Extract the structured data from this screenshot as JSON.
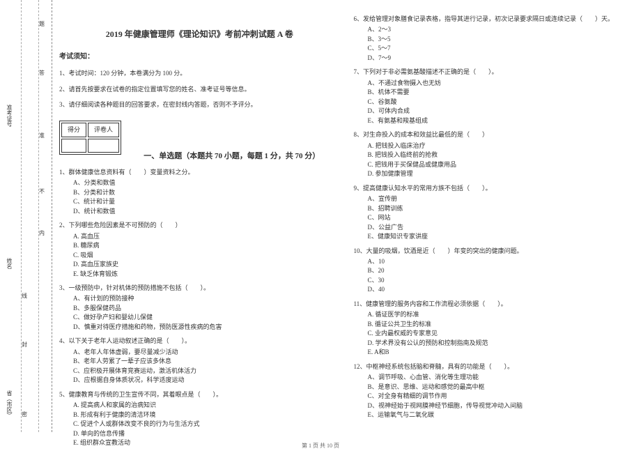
{
  "title": "2019 年健康管理师《理论知识》考前冲刺试题 A 卷",
  "noticeHeading": "考试须知：",
  "notices": [
    "1、考试时间：120 分钟，本卷满分为 100 分。",
    "2、请首先按要求在试卷的指定位置填写您的姓名、准考证号等信息。",
    "3、请仔细阅读各种题目的回答要求，在密封线内答题，否则不予评分。"
  ],
  "scoreHeaders": {
    "score": "得分",
    "reviewer": "评卷人"
  },
  "sectionTitle": "一、单选题（本题共 70 小题，每题 1 分，共 70 分）",
  "binding": {
    "province": "省（市区）",
    "seal": "密",
    "seal2": "封",
    "line": "线",
    "inner": "内",
    "dont": "不",
    "answer": "准",
    "do": "答",
    "question": "题",
    "name": "姓名",
    "admitNo": "准考证号"
  },
  "questions": [
    {
      "num": "1、",
      "text": "群体健康信息资料有（　　）变量资料之分。",
      "options": [
        "A、分类和数值",
        "B、分类和计数",
        "C、统计和计量",
        "D、统计和数值"
      ]
    },
    {
      "num": "2、",
      "text": "下列哪些危险因素是不可预防的（　　）",
      "options": [
        "A. 高血压",
        "B. 糖尿病",
        "C. 吸烟",
        "D. 高血压家族史",
        "E. 缺乏体育锻炼"
      ]
    },
    {
      "num": "3、",
      "text": "一级预防中，针对机体的预防措施不包括（　　）。",
      "options": [
        "A、有计划的预防接种",
        "B、多服保健药品",
        "C、做好孕产妇和婴幼儿保健",
        "D、慎重对待医疗措施和药物，预防医源性疾病的危害"
      ]
    },
    {
      "num": "4、",
      "text": "以下关于老年人运动叙述正确的是（　　）。",
      "options": [
        "A、老年人年体虚弱，要尽量减少活动",
        "B、老年人劳累了一辈子应该多休息",
        "C、应积极开展体育竞赛运动，激活机体活力",
        "D、应根据自身体质状况，科学适度运动"
      ]
    },
    {
      "num": "5、",
      "text": "健康教育与传统的卫生宣传不同，其着眼点是（　　）。",
      "options": [
        "A. 提高病人和家属的治病知识",
        "B. 形成有利于健康的清洁环境",
        "C. 促进个人或群体改变不良的行为与生活方式",
        "D. 单向的信息传播",
        "E. 组织群众宣教活动"
      ]
    },
    {
      "num": "6、",
      "text": "发给管理对象膳食记录表格，指导其进行记录，初次记录要求隔日或连续记录（　　）天。",
      "options": [
        "A、2～3",
        "B、3～5",
        "C、5～7",
        "D、7～9"
      ]
    },
    {
      "num": "7、",
      "text": "下列对于非必需氨基酸描述不正确的是（　　）。",
      "options": [
        "A、不通过食物摄入也无妨",
        "B、机体不需要",
        "C、谷氨酸",
        "D、可体内合成",
        "E、有氨基和羧基组成"
      ]
    },
    {
      "num": "8、",
      "text": "对生命投入的成本和效益比最低的是（　　）",
      "options": [
        "A. 把钱投入临床治疗",
        "B. 把钱投入临终前的抢救",
        "C. 把钱用于买保健品或健康用品",
        "D. 参加健康管理"
      ]
    },
    {
      "num": "9、",
      "text": "提高健康认知水平的常用方族不包括（　　）。",
      "options": [
        "A、宣传册",
        "B、招聘训练",
        "C、网站",
        "D、公益广告",
        "E、健康知识专家讲座"
      ]
    },
    {
      "num": "10、",
      "text": "大量的吸烟，饮酒是近（　　）年变的突出的健康问题。",
      "options": [
        "A、10",
        "B、20",
        "C、30",
        "D、40"
      ]
    },
    {
      "num": "11、",
      "text": "健康管理的服务内容和工作流程必须依据（　　）。",
      "options": [
        "A. 循证医学的标准",
        "B. 循证公共卫生的标准",
        "C. 业内最权威的专家意见",
        "D. 学术界没有公认的预防和控制指南及规范",
        "E. A和B"
      ]
    },
    {
      "num": "12、",
      "text": "中枢神经系统包括脑和脊髓，具有的功能是（　　）。",
      "options": [
        "A、调节呼吸、心血管、消化等生理功能",
        "B、是意识、思维、运动和感觉的最高中枢",
        "C、对全身有精细的调节作用",
        "D、视神经始于视网膜神经节细胞，传导视觉冲动入间脑",
        "E、运输氧气与二氧化碳"
      ]
    }
  ],
  "footer": "第 1 页 共 10 页"
}
